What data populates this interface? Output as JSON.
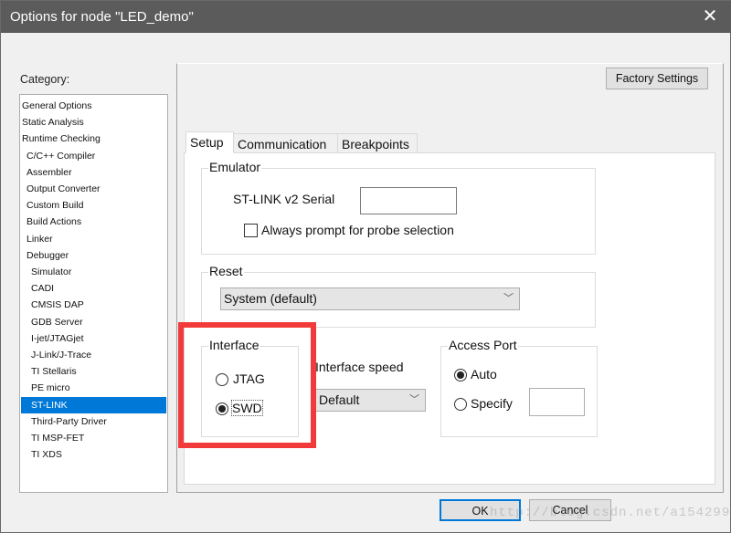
{
  "window": {
    "title": "Options for node \"LED_demo\"",
    "close": "✕"
  },
  "category": {
    "label": "Category:",
    "items": [
      "General Options",
      "Static Analysis",
      "Runtime Checking",
      "C/C++ Compiler",
      "Assembler",
      "Output Converter",
      "Custom Build",
      "Build Actions",
      "Linker",
      "Debugger",
      "Simulator",
      "CADI",
      "CMSIS DAP",
      "GDB Server",
      "I-jet/JTAGjet",
      "J-Link/J-Trace",
      "TI Stellaris",
      "PE micro",
      "ST-LINK",
      "Third-Party Driver",
      "TI MSP-FET",
      "TI XDS"
    ],
    "indent": [
      0,
      0,
      0,
      1,
      1,
      1,
      1,
      1,
      1,
      1,
      2,
      2,
      2,
      2,
      2,
      2,
      2,
      2,
      2,
      2,
      2,
      2
    ],
    "selected": "ST-LINK"
  },
  "factory_settings": "Factory Settings",
  "tabs": [
    "Setup",
    "Communication",
    "Breakpoints"
  ],
  "emulator": {
    "label": "Emulator",
    "serial_label": "ST-LINK v2  Serial",
    "serial_value": "",
    "prompt_label": "Always prompt for probe selection",
    "prompt_checked": false
  },
  "reset": {
    "label": "Reset",
    "value": "System (default)"
  },
  "interface": {
    "label": "Interface",
    "options": [
      "JTAG",
      "SWD"
    ],
    "selected": "SWD"
  },
  "interface_speed": {
    "label": "Interface speed",
    "value": "Default"
  },
  "access_port": {
    "label": "Access Port",
    "auto": "Auto",
    "specify": "Specify",
    "selected": "Auto",
    "specify_value": ""
  },
  "buttons": {
    "ok": "OK",
    "cancel": "Cancel"
  },
  "watermark": "http://blog.csdn.net/a154299",
  "colors": {
    "selection": "#0078d7",
    "highlight": "#f23a3a"
  }
}
